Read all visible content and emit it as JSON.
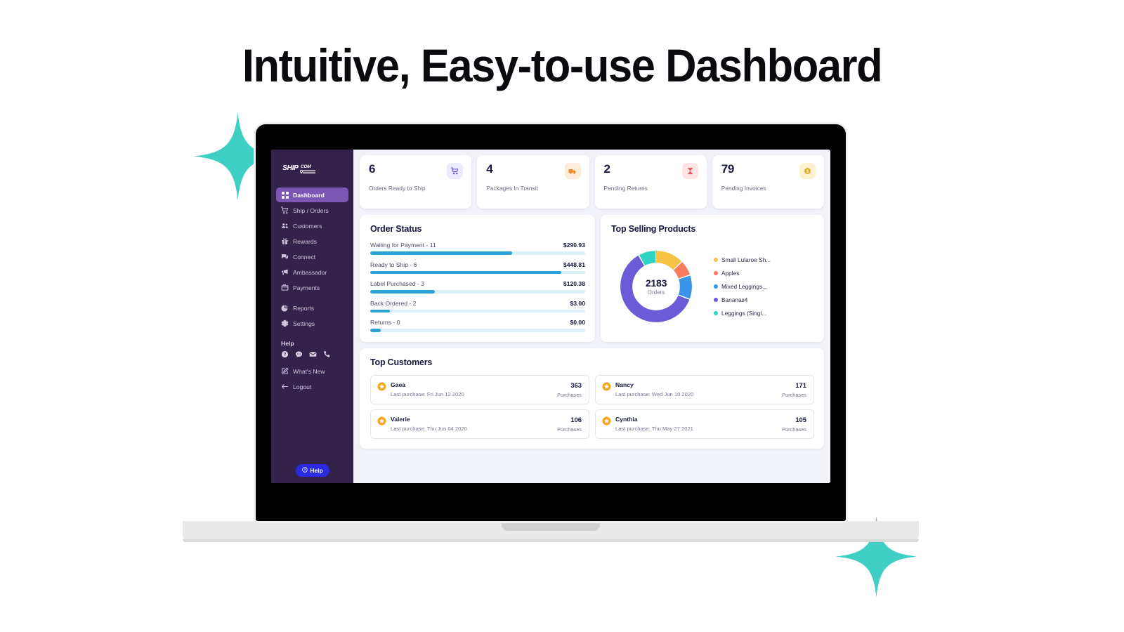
{
  "headline": "Intuitive, Easy-to-use Dashboard",
  "brand": {
    "name": "SHIP.COM",
    "part1": "SHIP",
    "part2": "COM"
  },
  "colors": {
    "sidebar_bg": "#33234a",
    "sidebar_active": "#7c55b5",
    "content_bg": "#f1f1f8",
    "bar_fill": "#29a3d5",
    "bar_track": "#dcf0f8",
    "help_button": "#2a2ae0",
    "sparkle": "#3fcfc4",
    "star": "#f5a623"
  },
  "sidebar": {
    "items": [
      {
        "label": "Dashboard",
        "icon": "grid-icon",
        "active": true
      },
      {
        "label": "Ship / Orders",
        "icon": "cart-icon",
        "active": false
      },
      {
        "label": "Customers",
        "icon": "users-icon",
        "active": false
      },
      {
        "label": "Rewards",
        "icon": "gift-icon",
        "active": false
      },
      {
        "label": "Connect",
        "icon": "chat-icon",
        "active": false
      },
      {
        "label": "Ambassador",
        "icon": "megaphone-icon",
        "active": false
      },
      {
        "label": "Payments",
        "icon": "wallet-icon",
        "active": false
      },
      {
        "label": "Reports",
        "icon": "pie-icon",
        "active": false
      },
      {
        "label": "Settings",
        "icon": "gear-icon",
        "active": false
      }
    ],
    "help_heading": "Help",
    "help_icons": [
      "question-circle-icon",
      "chat-bubble-icon",
      "envelope-icon",
      "phone-icon"
    ],
    "whats_new": {
      "label": "What's New",
      "icon": "edit-square-icon"
    },
    "logout": {
      "label": "Logout",
      "icon": "arrow-left-icon"
    },
    "help_button": {
      "label": "Help",
      "icon": "question-circle-icon"
    }
  },
  "stats": [
    {
      "value": "6",
      "label": "Orders Ready to Ship",
      "icon": "cart-icon",
      "badge_bg": "#eceaff",
      "icon_color": "#5b4fd4"
    },
    {
      "value": "4",
      "label": "Packages In Transit",
      "icon": "truck-icon",
      "badge_bg": "#fdecd9",
      "icon_color": "#f08a2e"
    },
    {
      "value": "2",
      "label": "Pending Returns",
      "icon": "hourglass-icon",
      "badge_bg": "#fde4e4",
      "icon_color": "#e35454"
    },
    {
      "value": "79",
      "label": "Pending Invoices",
      "icon": "coin-icon",
      "badge_bg": "#fdf1cf",
      "icon_color": "#e0a81e"
    }
  ],
  "order_status": {
    "title": "Order Status",
    "rows": [
      {
        "label": "Waiting for Payment - 11",
        "amount": "$290.93",
        "pct": 66
      },
      {
        "label": "Ready to Ship - 6",
        "amount": "$448.81",
        "pct": 89
      },
      {
        "label": "Label Purchased - 3",
        "amount": "$120.38",
        "pct": 30
      },
      {
        "label": "Back Ordered - 2",
        "amount": "$3.00",
        "pct": 9
      },
      {
        "label": "Returns - 0",
        "amount": "$0.00",
        "pct": 5
      }
    ]
  },
  "chart_data": {
    "type": "pie",
    "title": "Top Selling Products",
    "center_value": "2183",
    "center_label": "Orders",
    "total": 2183,
    "categories": [
      "Small Lularoe Sh...",
      "Apples",
      "Mixed Leggings...",
      "Bananas4",
      "Leggings (Singl..."
    ],
    "values": [
      13,
      7,
      11,
      61,
      8
    ],
    "colors": [
      "#f6c344",
      "#f97b5e",
      "#3b93e8",
      "#6b5bd6",
      "#2dd4c4"
    ],
    "legend_position": "right",
    "xlabel": "",
    "ylabel": ""
  },
  "top_customers": {
    "title": "Top Customers",
    "purchases_label": "Purchases",
    "items": [
      {
        "name": "Gaea",
        "date": "Last purchase: Fri Jun 12 2020",
        "count": "363",
        "icon": "star-icon"
      },
      {
        "name": "Nancy",
        "date": "Last purchase: Wed Jun 10 2020",
        "count": "171",
        "icon": "star-icon"
      },
      {
        "name": "Valerie",
        "date": "Last purchase: Thu Jun 04 2020",
        "count": "106",
        "icon": "star-icon"
      },
      {
        "name": "Cynthia",
        "date": "Last purchase: Thu May 27 2021",
        "count": "105",
        "icon": "star-icon"
      }
    ]
  }
}
